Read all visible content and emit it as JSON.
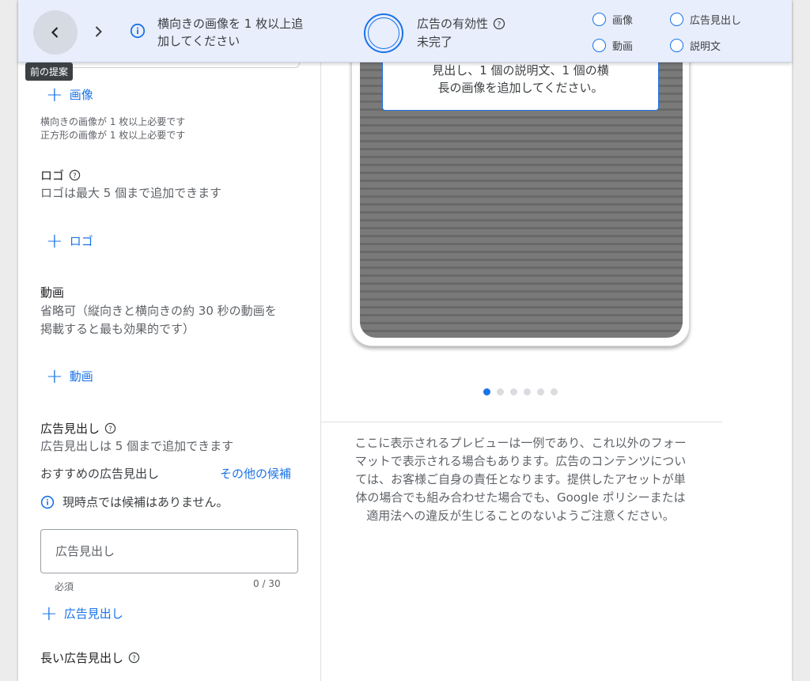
{
  "colors": {
    "accent": "#1a73e8",
    "topbar_bg": "#e8eefb",
    "text": "#3c4043",
    "secondary": "#5f6368"
  },
  "topbar": {
    "prev_icon": "chevron-left-icon",
    "next_icon": "chevron-right-icon",
    "info_icon": "info-icon",
    "message_line1": "横向きの画像を 1 枚以上追",
    "message_line2": "加してください",
    "strength_title": "広告の有効性",
    "strength_help_icon": "help-icon",
    "strength_status": "未完了",
    "checklist": [
      "画像",
      "広告見出し",
      "動画",
      "説明文"
    ]
  },
  "tooltip": "前の提案",
  "left": {
    "add_image": "画像",
    "image_req_1": "横向きの画像が 1 枚以上必要です",
    "image_req_2": "正方形の画像が 1 枚以上必要です",
    "logo_title": "ロゴ",
    "logo_desc": "ロゴは最大 5 個まで追加できます",
    "add_logo": "ロゴ",
    "video_title": "動画",
    "video_desc_1": "省略可（縦向きと横向きの約 30 秒の動画を",
    "video_desc_2": "掲載すると最も効果的です）",
    "add_video": "動画",
    "headline_title": "広告見出し",
    "headline_desc": "広告見出しは 5 個まで追加できます",
    "recommended_label": "おすすめの広告見出し",
    "more_suggestions": "その他の候補",
    "no_suggestions": "現時点では候補はありません。",
    "headline_placeholder": "広告見出し",
    "required": "必須",
    "counter": "0 / 30",
    "add_headline": "広告見出し",
    "long_headline_title": "長い広告見出し"
  },
  "preview": {
    "card_line1": "見出し、1 個の説明文、1 個の横",
    "card_line2": "長の画像を追加してください。",
    "dots_total": 6,
    "dots_active_index": 0,
    "disclaimer_lines": [
      "ここに表示されるプレビューは一例であり、これ以外のフォー",
      "マットで表示される場合もあります。広告のコンテンツについ",
      "ては、お客様ご自身の責任となります。提供したアセットが単",
      "体の場合でも組み合わせた場合でも、Google ポリシーまたは",
      "適用法への違反が生じることのないようご注意ください。"
    ]
  }
}
